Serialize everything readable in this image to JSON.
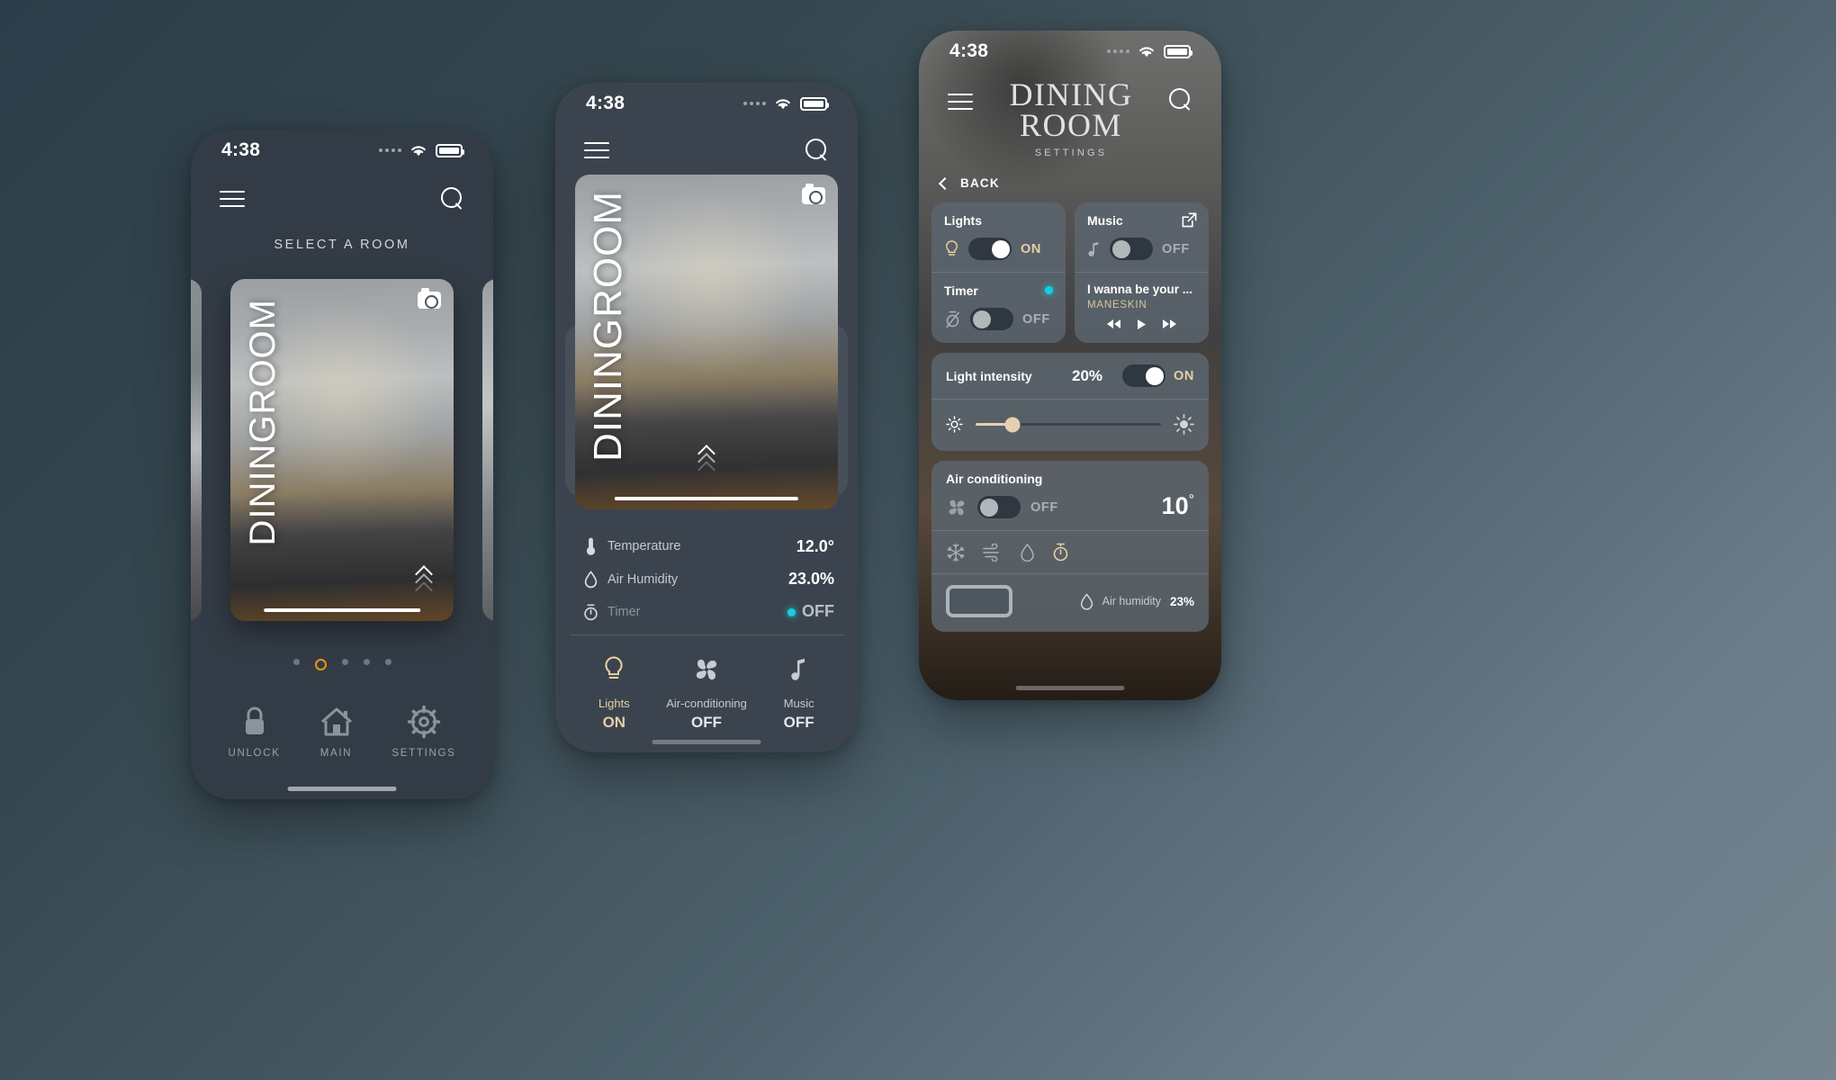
{
  "background": {
    "from": "#2c3d49",
    "to": "#74858f"
  },
  "accent": {
    "gold": "#e6cfa4",
    "orange": "#f0930d",
    "cyan": "#12cfe0"
  },
  "phone1": {
    "status": {
      "time": "4:38",
      "wifi": "wifi-icon",
      "battery": "battery-icon"
    },
    "nav": {
      "menu": "hamburger-icon",
      "search": "search-icon"
    },
    "title": "SELECT A ROOM",
    "card": {
      "room_label": "DININGROOM",
      "camera": "camera-icon",
      "expand": "chevron-up-icon"
    },
    "pager": {
      "count": 5,
      "active_index": 1
    },
    "tabs": [
      {
        "label": "UNLOCK",
        "icon": "lock-icon"
      },
      {
        "label": "MAIN",
        "icon": "home-icon"
      },
      {
        "label": "SETTINGS",
        "icon": "gear-icon"
      }
    ]
  },
  "phone2": {
    "status": {
      "time": "4:38"
    },
    "nav": {
      "menu": "hamburger-icon",
      "search": "search-icon"
    },
    "card": {
      "room_label": "DININGROOM",
      "camera": "camera-icon",
      "expand": "chevron-up-icon"
    },
    "stats": [
      {
        "icon": "thermometer-icon",
        "name": "Temperature",
        "value": "12.0°",
        "dim": false,
        "dot": false
      },
      {
        "icon": "droplet-icon",
        "name": "Air Humidity",
        "value": "23.0%",
        "dim": false,
        "dot": false
      },
      {
        "icon": "timer-icon",
        "name": "Timer",
        "value": "OFF",
        "dim": true,
        "dot": true
      }
    ],
    "tabs": [
      {
        "icon": "bulb-icon",
        "name": "Lights",
        "state": "ON",
        "active": true
      },
      {
        "icon": "fan-icon",
        "name": "Air-conditioning",
        "state": "OFF",
        "active": false
      },
      {
        "icon": "music-note-icon",
        "name": "Music",
        "state": "OFF",
        "active": false
      }
    ]
  },
  "phone3": {
    "status": {
      "time": "4:38"
    },
    "nav": {
      "menu": "hamburger-icon",
      "search": "search-icon"
    },
    "title_line1": "DINING",
    "title_line2": "ROOM",
    "subtitle": "SETTINGS",
    "back": {
      "label": "BACK",
      "icon": "chevron-left-icon"
    },
    "lights": {
      "title": "Lights",
      "icon": "bulb-icon",
      "state": "ON",
      "on": true
    },
    "timer": {
      "title": "Timer",
      "icon": "timer-off-icon",
      "state": "OFF",
      "on": false,
      "dot": true
    },
    "music": {
      "title": "Music",
      "icon": "music-note-icon",
      "link": "external-link-icon",
      "state": "OFF",
      "on": false,
      "track": "I wanna be your ...",
      "artist": "MANESKIN",
      "controls": [
        "rewind-icon",
        "play-icon",
        "forward-icon"
      ]
    },
    "light_intensity": {
      "title": "Light intensity",
      "value": "20%",
      "state": "ON",
      "on": true,
      "percent": 20,
      "icon_low": "brightness-low-icon",
      "icon_high": "brightness-high-icon"
    },
    "air_conditioning": {
      "title": "Air conditioning",
      "icon": "fan-icon",
      "state": "OFF",
      "on": false,
      "temperature": "10",
      "degree": "°",
      "modes": [
        {
          "icon": "snowflake-icon",
          "active": false
        },
        {
          "icon": "wind-icon",
          "active": false
        },
        {
          "icon": "droplet-icon",
          "active": false
        },
        {
          "icon": "timer-icon",
          "active": true
        }
      ],
      "humidity_label": "Air humidity",
      "humidity_value": "23%",
      "humidity_icon": "droplet-icon"
    }
  }
}
